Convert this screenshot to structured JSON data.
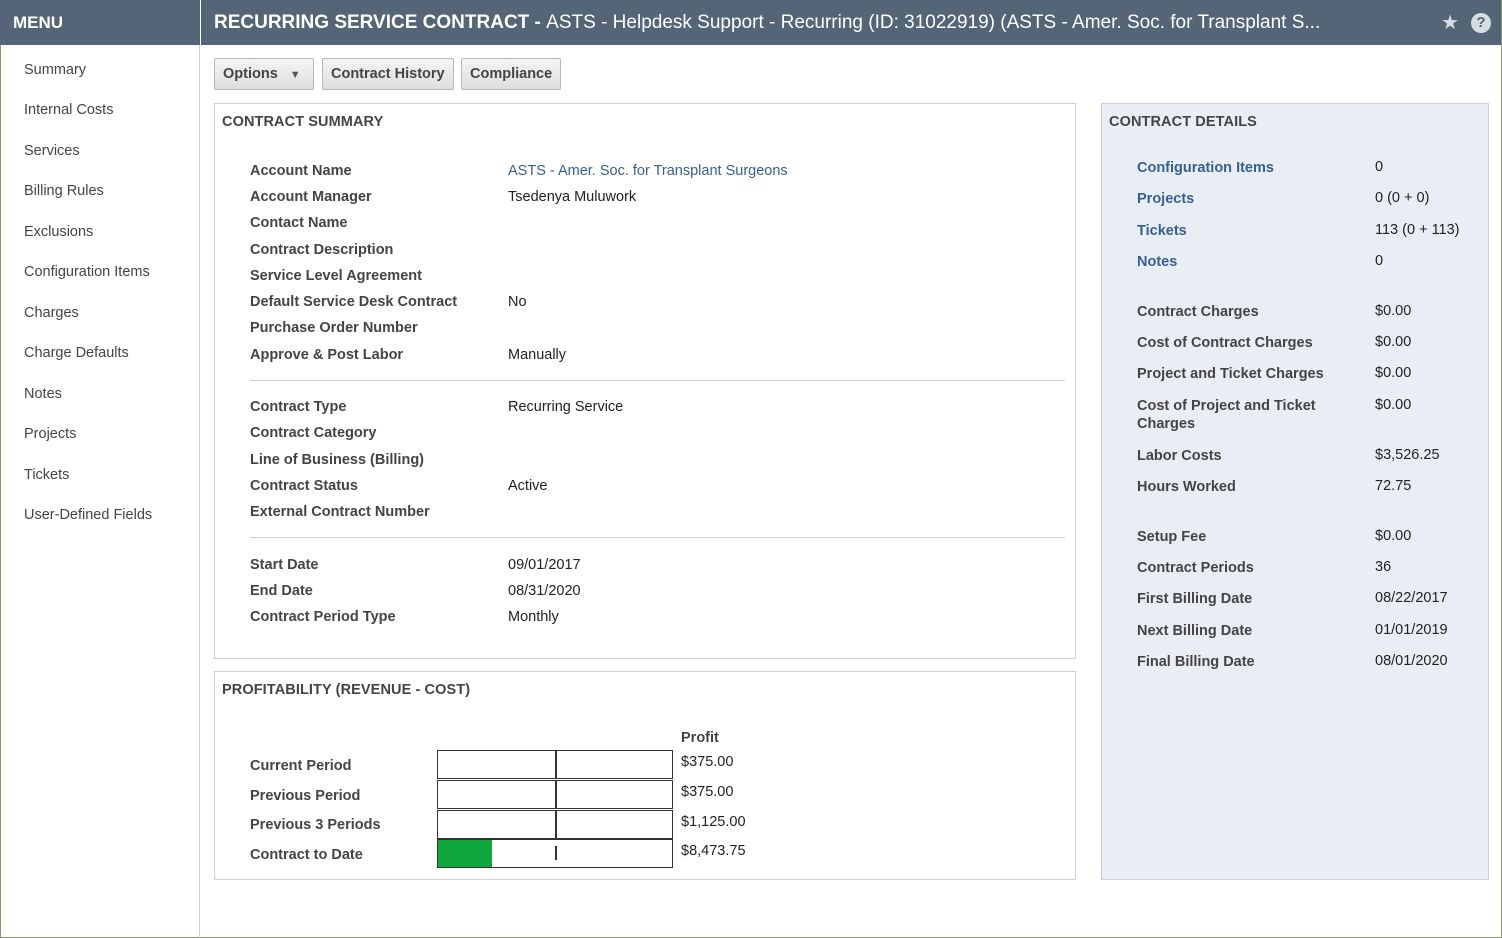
{
  "menu": {
    "title": "MENU",
    "items": [
      "Summary",
      "Internal Costs",
      "Services",
      "Billing Rules",
      "Exclusions",
      "Configuration Items",
      "Charges",
      "Charge Defaults",
      "Notes",
      "Projects",
      "Tickets",
      "User-Defined Fields"
    ]
  },
  "header": {
    "title_bold": "RECURRING SERVICE CONTRACT - ",
    "title_rest": "ASTS - Helpdesk Support - Recurring (ID: 31022919) (ASTS - Amer. Soc. for Transplant S..."
  },
  "toolbar": {
    "options": "Options",
    "contract_history": "Contract History",
    "compliance": "Compliance"
  },
  "summary": {
    "title": "CONTRACT SUMMARY",
    "group1": [
      {
        "label": "Account Name",
        "value": "ASTS - Amer. Soc. for Transplant Surgeons",
        "link": true
      },
      {
        "label": "Account Manager",
        "value": "Tsedenya Muluwork"
      },
      {
        "label": "Contact Name",
        "value": ""
      },
      {
        "label": "Contract Description",
        "value": ""
      },
      {
        "label": "Service Level Agreement",
        "value": ""
      },
      {
        "label": "Default Service Desk Contract",
        "value": "No"
      },
      {
        "label": "Purchase Order Number",
        "value": ""
      },
      {
        "label": "Approve & Post Labor",
        "value": "Manually"
      }
    ],
    "group2": [
      {
        "label": "Contract Type",
        "value": "Recurring Service"
      },
      {
        "label": "Contract Category",
        "value": ""
      },
      {
        "label": "Line of Business (Billing)",
        "value": ""
      },
      {
        "label": "Contract Status",
        "value": "Active"
      },
      {
        "label": "External Contract Number",
        "value": ""
      }
    ],
    "group3": [
      {
        "label": "Start Date",
        "value": "09/01/2017"
      },
      {
        "label": "End Date",
        "value": "08/31/2020"
      },
      {
        "label": "Contract Period Type",
        "value": "Monthly"
      }
    ]
  },
  "profitability": {
    "title": "PROFITABILITY (REVENUE - COST)",
    "column_header": "Profit",
    "rows": [
      {
        "label": "Current Period",
        "value": "$375.00",
        "fill_fraction": 0
      },
      {
        "label": "Previous Period",
        "value": "$375.00",
        "fill_fraction": 0
      },
      {
        "label": "Previous 3 Periods",
        "value": "$1,125.00",
        "fill_fraction": 0
      },
      {
        "label": "Contract to Date",
        "value": "$8,473.75",
        "fill_fraction": 0.23
      }
    ],
    "fill_color": "#10a83c"
  },
  "details": {
    "title": "CONTRACT DETAILS",
    "group1": [
      {
        "label": "Configuration Items",
        "value": "0",
        "link": true
      },
      {
        "label": "Projects",
        "value": "0 (0 + 0)",
        "link": true
      },
      {
        "label": "Tickets",
        "value": "113 (0 + 113)",
        "link": true
      },
      {
        "label": "Notes",
        "value": "0",
        "link": true
      }
    ],
    "group2": [
      {
        "label": "Contract Charges",
        "value": "$0.00"
      },
      {
        "label": "Cost of Contract Charges",
        "value": "$0.00"
      },
      {
        "label": "Project and Ticket Charges",
        "value": "$0.00"
      },
      {
        "label": "Cost of Project and Ticket Charges",
        "value": "$0.00"
      },
      {
        "label": "Labor Costs",
        "value": "$3,526.25"
      },
      {
        "label": "Hours Worked",
        "value": "72.75"
      }
    ],
    "group3": [
      {
        "label": "Setup Fee",
        "value": "$0.00"
      },
      {
        "label": "Contract Periods",
        "value": "36"
      },
      {
        "label": "First Billing Date",
        "value": "08/22/2017"
      },
      {
        "label": "Next Billing Date",
        "value": "01/01/2019"
      },
      {
        "label": "Final Billing Date",
        "value": "08/01/2020"
      }
    ]
  },
  "colors": {
    "header_bg": "#546578",
    "link": "#376092",
    "details_bg": "#e9eef5"
  }
}
